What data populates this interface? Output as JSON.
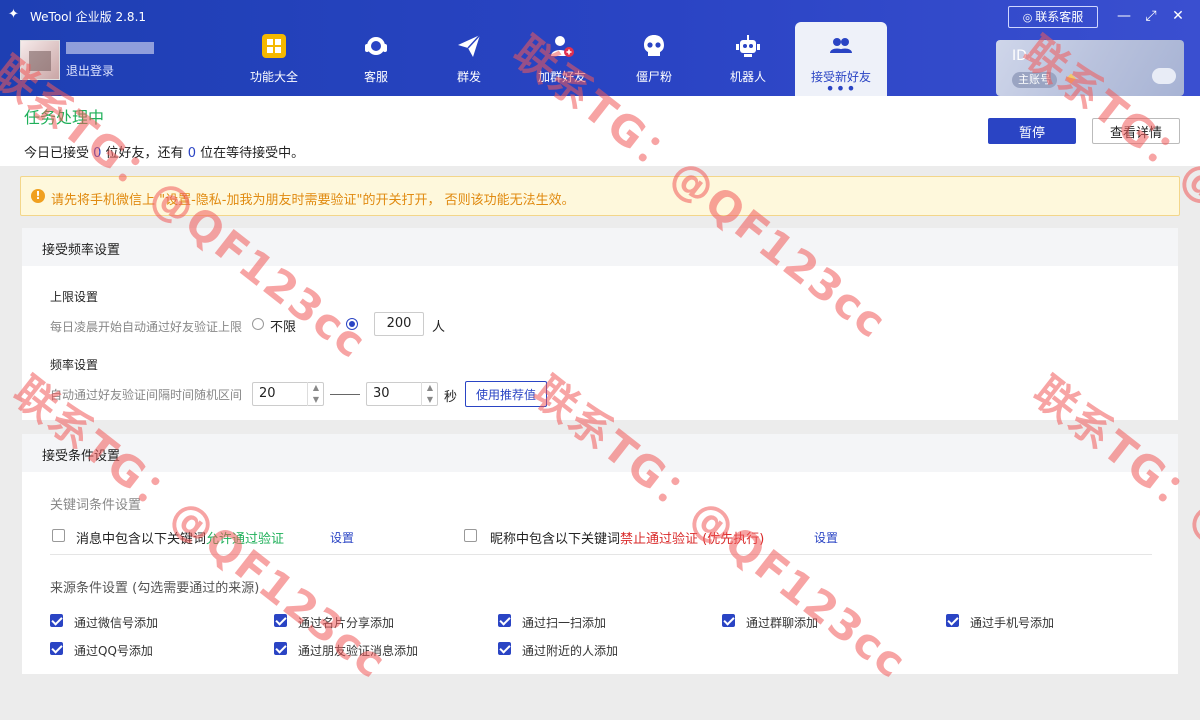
{
  "app": {
    "title": "WeTool 企业版 2.8.1",
    "contact_label": "联系客服"
  },
  "user": {
    "logout_label": "退出登录"
  },
  "nav": [
    {
      "label": "功能大全",
      "icon": "grid-icon"
    },
    {
      "label": "客服",
      "icon": "headset-icon"
    },
    {
      "label": "群发",
      "icon": "paper-plane-icon"
    },
    {
      "label": "加群好友",
      "icon": "add-user-icon"
    },
    {
      "label": "僵尸粉",
      "icon": "skull-icon"
    },
    {
      "label": "机器人",
      "icon": "robot-icon"
    },
    {
      "label": "接受新好友",
      "icon": "users-icon",
      "active": true
    }
  ],
  "account": {
    "id_label": "ID:",
    "badge": "主账号"
  },
  "status": {
    "title": "任务处理中",
    "prefix": "今日已接受 ",
    "accepted": "0",
    "middle": " 位好友，还有 ",
    "waiting": "0",
    "suffix": " 位在等待接受中。",
    "pause_label": "暂停",
    "detail_label": "查看详情"
  },
  "warning": "请先将手机微信上 \"设置-隐私-加我为朋友时需要验证\"的开关打开， 否则该功能无法生效。",
  "frequency": {
    "title": "接受频率设置",
    "limit_label": "上限设置",
    "limit_desc": "每日凌晨开始自动通过好友验证上限",
    "unlimited_label": "不限",
    "limit_value": "200",
    "limit_unit": "人",
    "rate_label": "频率设置",
    "rate_desc": "自动通过好友验证间隔时间随机区间",
    "rate_min": "20",
    "rate_max": "30",
    "rate_unit": "秒",
    "recommend_label": "使用推荐值"
  },
  "conditions": {
    "title": "接受条件设置",
    "keyword_label": "关键词条件设置",
    "msg_prefix": "消息中包含以下关键词",
    "msg_action": "允许通过验证",
    "nick_prefix": "昵称中包含以下关键词",
    "nick_action": "禁止通过验证 (优先执行)",
    "setting_label": "设置",
    "source_label": "来源条件设置 (勾选需要通过的来源)",
    "sources": [
      "通过微信号添加",
      "通过名片分享添加",
      "通过扫一扫添加",
      "通过群聊添加",
      "通过手机号添加",
      "通过QQ号添加",
      "通过朋友验证消息添加",
      "通过附近的人添加"
    ]
  },
  "watermark": "联系TG：@QF123cc",
  "colors": {
    "primary": "#2a44c4",
    "success": "#1fb05a",
    "danger": "#d92b2b",
    "warning": "#e08a10"
  }
}
